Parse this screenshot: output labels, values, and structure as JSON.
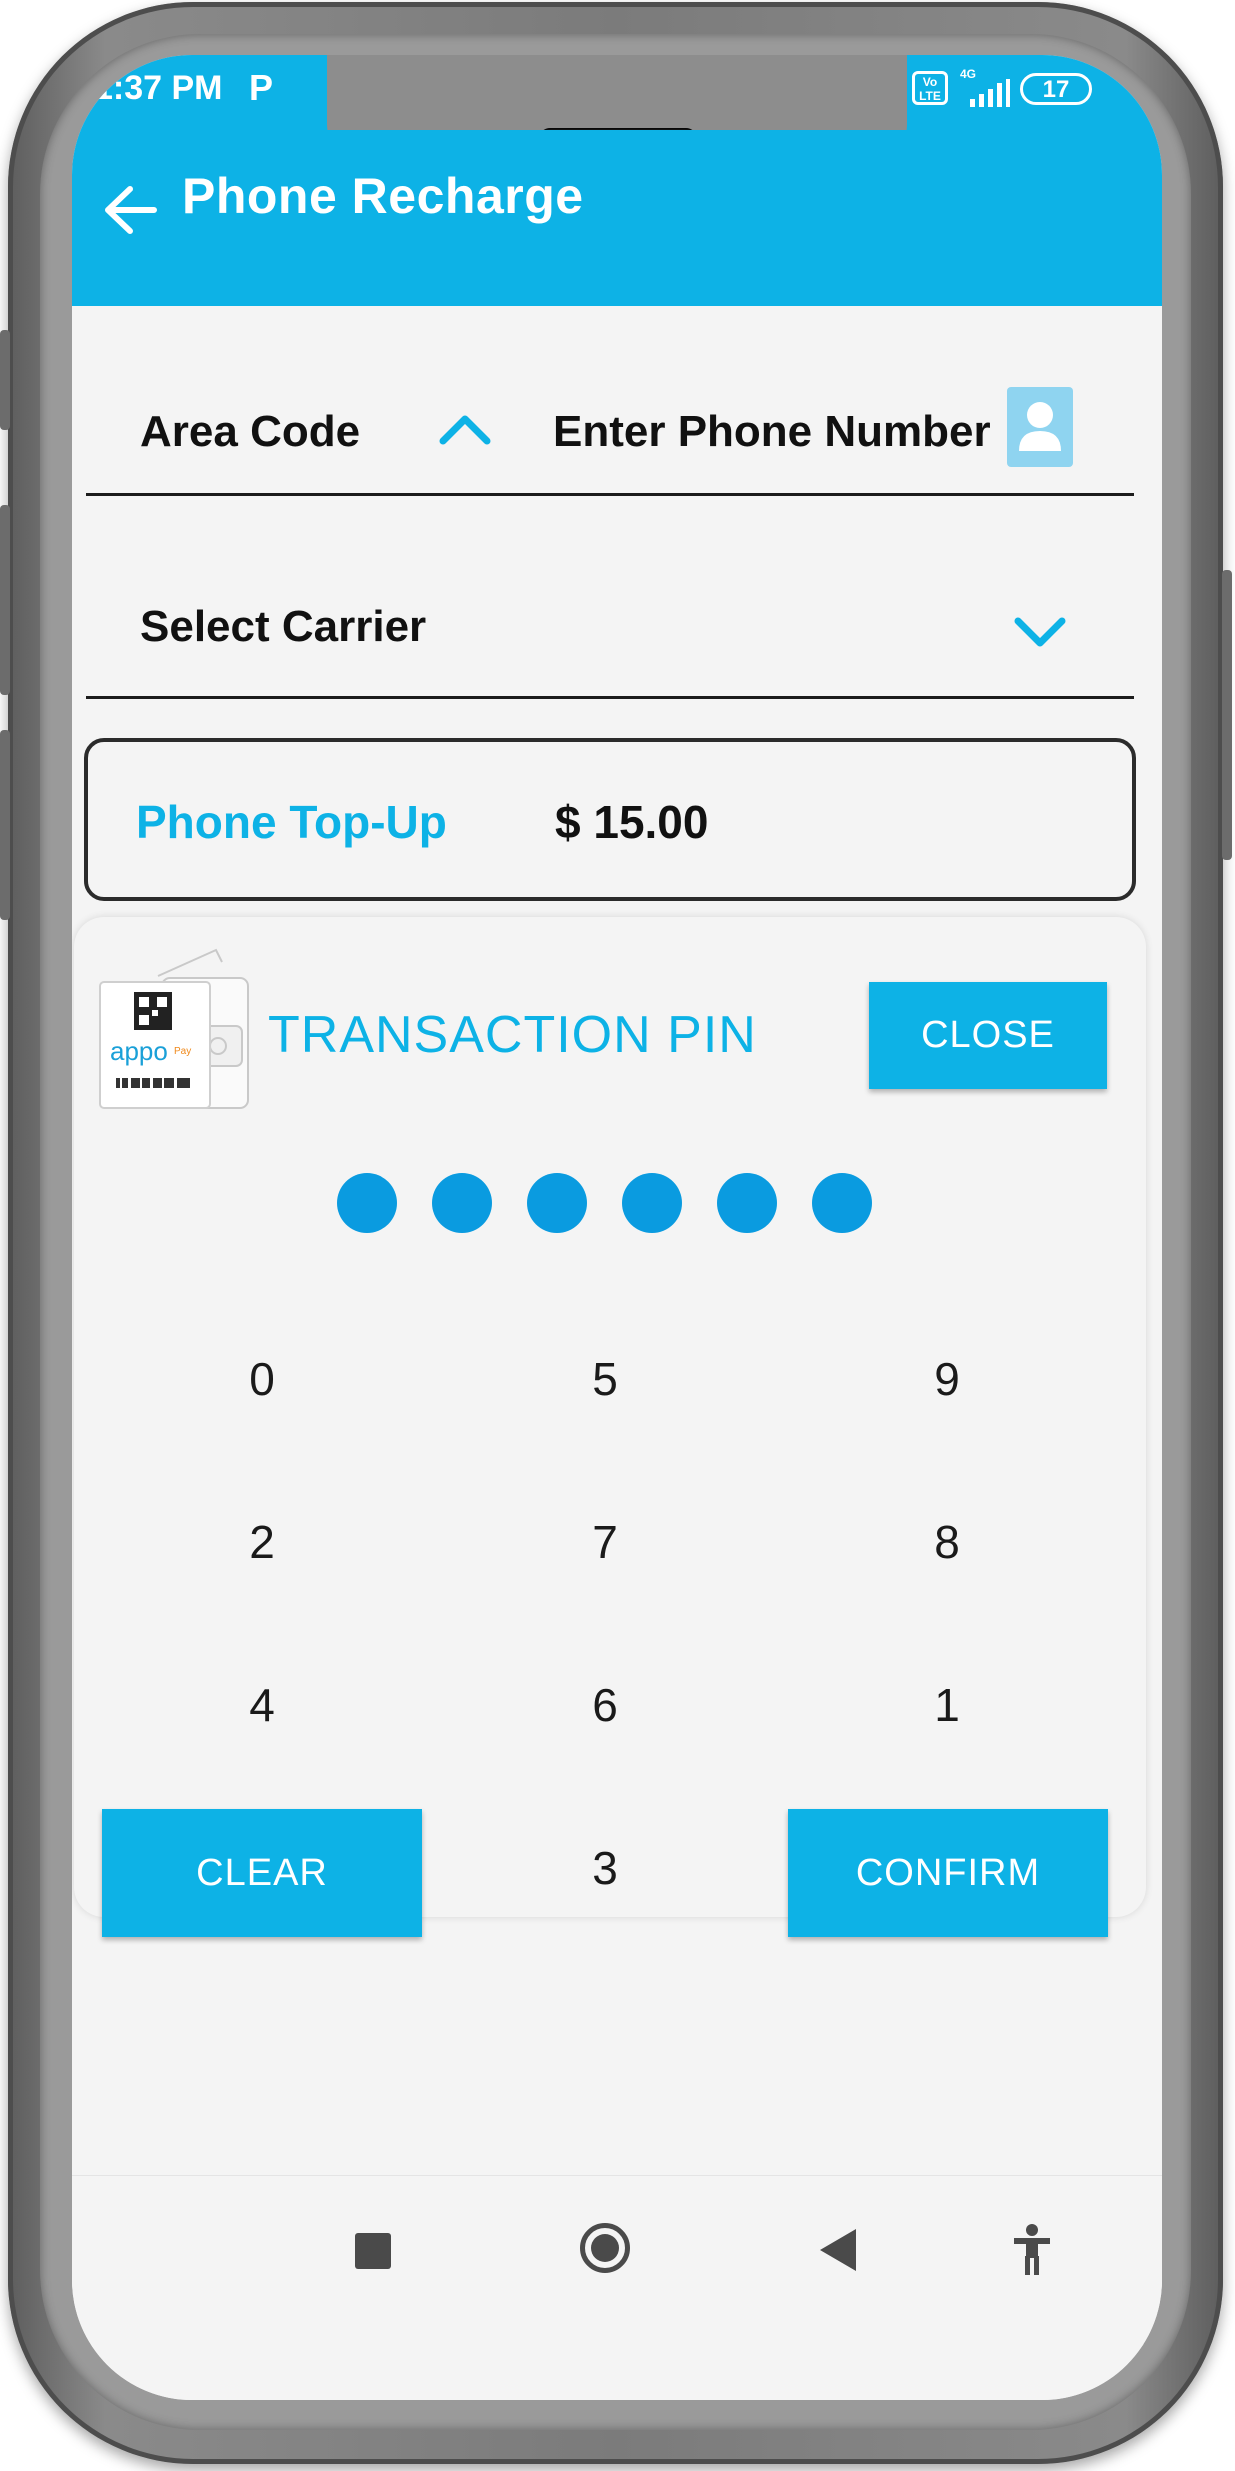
{
  "status_bar": {
    "time": "1:37 PM",
    "notification_icon": "P",
    "volte_badge": "Vo LTE",
    "network": "4G",
    "battery_level": "17"
  },
  "app_bar": {
    "back_icon": "arrow-left-icon",
    "title": "Phone Recharge"
  },
  "phone_field": {
    "area_code_label": "Area Code",
    "area_code_toggle_icon": "chevron-up-icon",
    "phone_placeholder": "Enter Phone Number",
    "contact_icon": "contact-icon"
  },
  "carrier_field": {
    "label": "Select Carrier",
    "dropdown_icon": "chevron-down-icon"
  },
  "topup": {
    "label": "Phone Top-Up",
    "amount": "$ 15.00"
  },
  "pin_dialog": {
    "title": "TRANSACTION PIN",
    "card_logo_text": "appo",
    "close_label": "CLOSE",
    "pin_entered_count": 6,
    "keypad_rows": [
      [
        "0",
        "5",
        "9"
      ],
      [
        "2",
        "7",
        "8"
      ],
      [
        "4",
        "6",
        "1"
      ]
    ],
    "bottom_key": "3",
    "clear_label": "CLEAR",
    "confirm_label": "CONFIRM"
  },
  "nav_bar": {
    "recents_icon": "square-icon",
    "home_icon": "circle-home-icon",
    "back_icon": "triangle-back-icon",
    "accessibility_icon": "accessibility-icon"
  },
  "colors": {
    "accent": "#0db2e6",
    "pin_dot": "#0a9be0",
    "background": "#f4f4f4",
    "text": "#111111"
  }
}
